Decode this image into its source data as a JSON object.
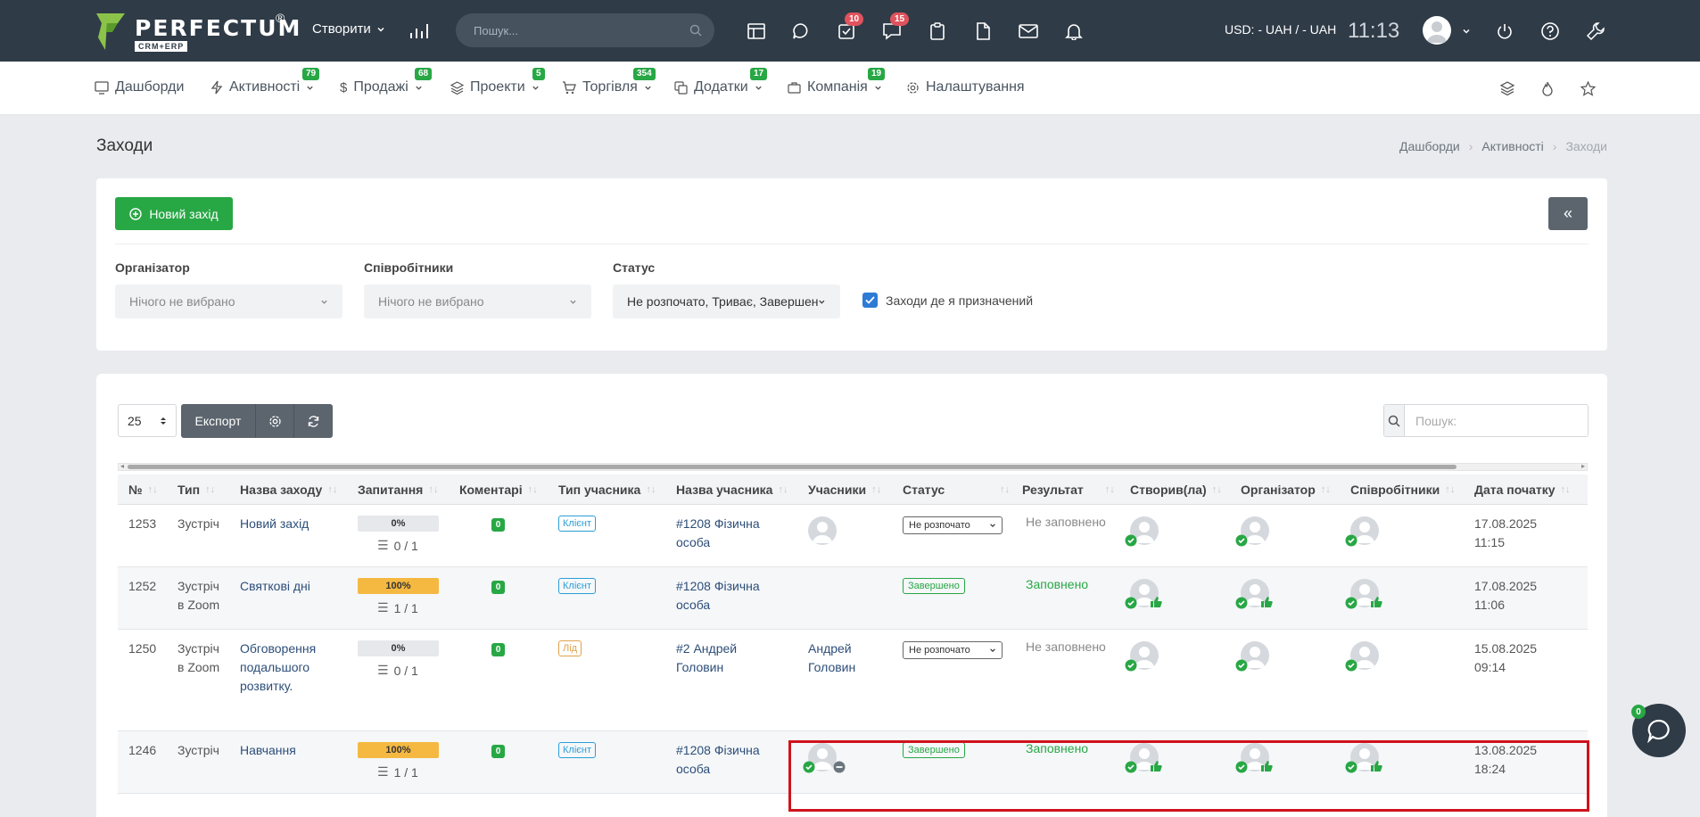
{
  "topbar": {
    "logo_text": "PERFECTUM",
    "logo_reg": "®",
    "logo_sub": "CRM+ERP",
    "create_label": "Створити",
    "search_placeholder": "Пошук...",
    "tasks_badge": "10",
    "chat_badge": "15",
    "currency": "USD: - UAH / - UAH",
    "time": "11:13"
  },
  "nav": {
    "items": [
      {
        "label": "Дашборди",
        "icon": "monitor-icon",
        "badge": ""
      },
      {
        "label": "Активності",
        "icon": "bolt-icon",
        "badge": "79"
      },
      {
        "label": "Продажі",
        "icon": "dollar-icon",
        "badge": "68"
      },
      {
        "label": "Проекти",
        "icon": "layers-icon",
        "badge": "5"
      },
      {
        "label": "Торгівля",
        "icon": "cart-icon",
        "badge": "354"
      },
      {
        "label": "Додатки",
        "icon": "copy-icon",
        "badge": "17"
      },
      {
        "label": "Компанія",
        "icon": "briefcase-icon",
        "badge": "19"
      },
      {
        "label": "Налаштування",
        "icon": "gear-icon",
        "badge": ""
      }
    ]
  },
  "page": {
    "title": "Заходи",
    "breadcrumb": [
      "Дашборди",
      "Активності",
      "Заходи"
    ]
  },
  "filters": {
    "new_button": "Новий захід",
    "collapse_button": "«",
    "organizer_label": "Організатор",
    "organizer_value": "Нічого не вибрано",
    "employees_label": "Співробітники",
    "employees_value": "Нічого не вибрано",
    "status_label": "Статус",
    "status_value": "Не розпочато, Триває, Завершено",
    "assigned_label": "Заходи де я призначений",
    "assigned_checked": true
  },
  "table_tools": {
    "page_size": "25",
    "export_label": "Експорт",
    "search_placeholder": "Пошук:"
  },
  "table": {
    "columns": [
      "№",
      "Тип",
      "Назва заходу",
      "Запитання",
      "Коментарі",
      "Тип учасника",
      "Назва учасника",
      "Учасники",
      "Статус",
      "Результат",
      "Створив(ла)",
      "Організатор",
      "Співробітники",
      "Дата початку"
    ],
    "rows": [
      {
        "num": "1253",
        "type": [
          "Зустріч"
        ],
        "name": [
          "Новий захід"
        ],
        "progress": "0%",
        "progress_value": 0,
        "tasks": "0 / 1",
        "comments": "0",
        "ptype": "Клієнт",
        "pname": [
          "#1208 Фізична",
          "особа"
        ],
        "participants": "",
        "status": "Не розпочато",
        "result": "Не заповнено",
        "date": [
          "17.08.2025",
          "11:15"
        ]
      },
      {
        "num": "1252",
        "type": [
          "Зустріч",
          "в Zoom"
        ],
        "name": [
          "Святкові дні"
        ],
        "progress": "100%",
        "progress_value": 100,
        "tasks": "1 / 1",
        "comments": "0",
        "ptype": "Клієнт",
        "pname": [
          "#1208 Фізична",
          "особа"
        ],
        "participants": "",
        "status": "Завершено",
        "result": "Заповнено",
        "date": [
          "17.08.2025",
          "11:06"
        ]
      },
      {
        "num": "1250",
        "type": [
          "Зустріч",
          "в Zoom"
        ],
        "name": [
          "Обговорення",
          "подальшого",
          "розвитку."
        ],
        "progress": "0%",
        "progress_value": 0,
        "tasks": "0 / 1",
        "comments": "0",
        "ptype": "Лід",
        "pname": [
          "#2 Андрей",
          "Головин"
        ],
        "participants": [
          "Андрей",
          "Головин"
        ],
        "status": "Не розпочато",
        "result": "Не заповнено",
        "date": [
          "15.08.2025",
          "09:14"
        ]
      },
      {
        "num": "1246",
        "type": [
          "Зустріч"
        ],
        "name": [
          "Навчання"
        ],
        "progress": "100%",
        "progress_value": 100,
        "tasks": "1 / 1",
        "comments": "0",
        "ptype": "Клієнт",
        "pname": [
          "#1208 Фізична",
          "особа"
        ],
        "participants": "",
        "status": "Завершено",
        "result": "Заповнено",
        "date": [
          "13.08.2025",
          "18:24"
        ]
      }
    ]
  },
  "chat_widget": {
    "badge": "0"
  },
  "colors": {
    "topbar": "#2f3b47",
    "green": "#28a745",
    "link": "#2d4e79",
    "highlight": "#d0121b"
  }
}
